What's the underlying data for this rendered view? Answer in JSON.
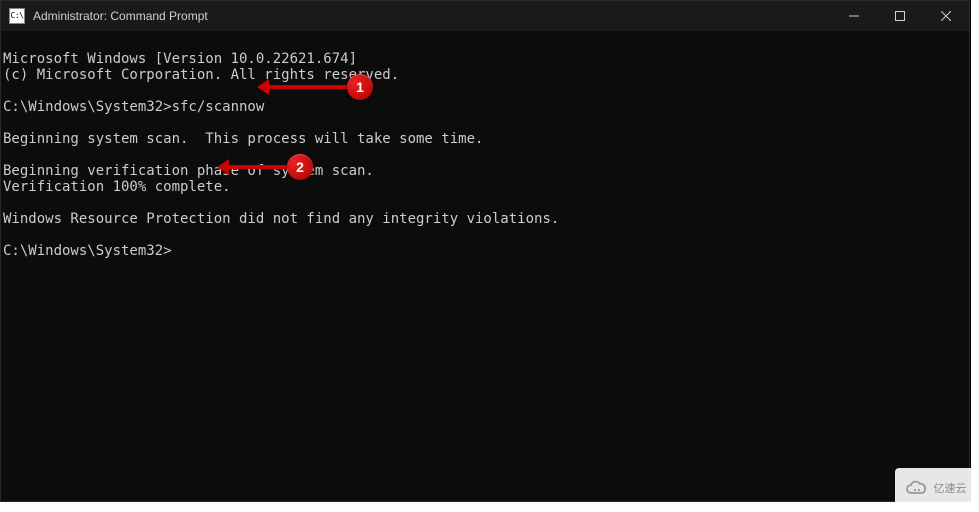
{
  "titlebar": {
    "icon_label": "C:\\",
    "title": "Administrator: Command Prompt"
  },
  "terminal": {
    "line1": "Microsoft Windows [Version 10.0.22621.674]",
    "line2": "(c) Microsoft Corporation. All rights reserved.",
    "blank1": "",
    "prompt1_prefix": "C:\\Windows\\System32>",
    "prompt1_cmd": "sfc/scannow",
    "blank2": "",
    "line3": "Beginning system scan.  This process will take some time.",
    "blank3": "",
    "line4": "Beginning verification phase of system scan.",
    "line5": "Verification 100% complete.",
    "blank4": "",
    "line6": "Windows Resource Protection did not find any integrity violations.",
    "blank5": "",
    "prompt2": "C:\\Windows\\System32>"
  },
  "annotations": {
    "badge1": "1",
    "badge2": "2"
  },
  "watermark": {
    "text": "亿速云"
  }
}
